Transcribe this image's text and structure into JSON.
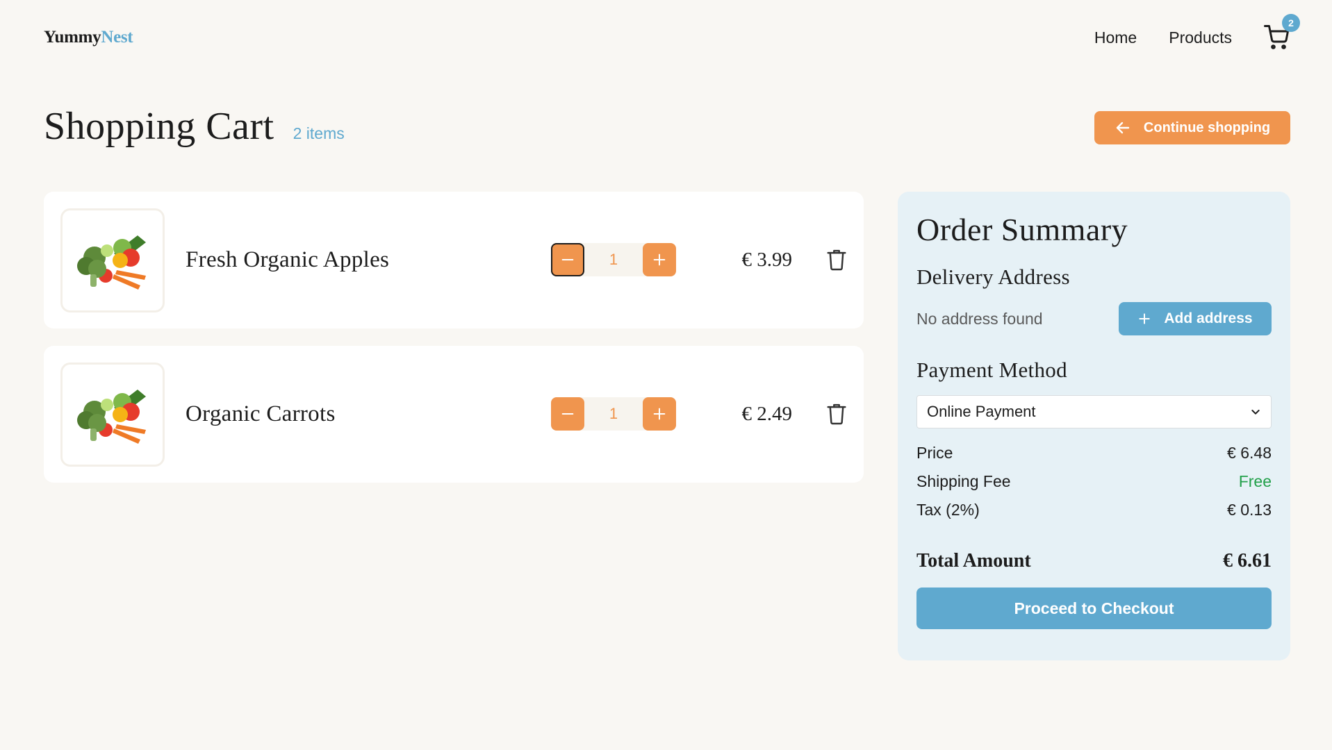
{
  "brand": {
    "part1": "Yummy",
    "part2": "Nest"
  },
  "nav": {
    "home": "Home",
    "products": "Products",
    "cart_count": "2"
  },
  "page": {
    "title": "Shopping Cart",
    "item_count": "2 items",
    "continue_label": "Continue shopping"
  },
  "cart": {
    "items": [
      {
        "name": "Fresh Organic Apples",
        "qty": "1",
        "price": "€ 3.99"
      },
      {
        "name": "Organic Carrots",
        "qty": "1",
        "price": "€ 2.49"
      }
    ]
  },
  "summary": {
    "title": "Order Summary",
    "delivery_heading": "Delivery Address",
    "no_address": "No address found",
    "add_address_label": "Add address",
    "payment_heading": "Payment Method",
    "payment_selected": "Online Payment",
    "price_label": "Price",
    "price_value": "€ 6.48",
    "shipping_label": "Shipping Fee",
    "shipping_value": "Free",
    "tax_label": "Tax (2%)",
    "tax_value": "€ 0.13",
    "total_label": "Total Amount",
    "total_value": "€ 6.61",
    "checkout_label": "Proceed to Checkout"
  },
  "colors": {
    "accent_orange": "#f0954e",
    "accent_blue": "#5fa9cf",
    "free_green": "#22a04a",
    "background": "#f9f7f3",
    "summary_bg": "#e6f1f6"
  },
  "icons": [
    "cart-icon",
    "arrow-left-icon",
    "minus-icon",
    "plus-icon",
    "trash-icon",
    "chevron-down-icon"
  ]
}
